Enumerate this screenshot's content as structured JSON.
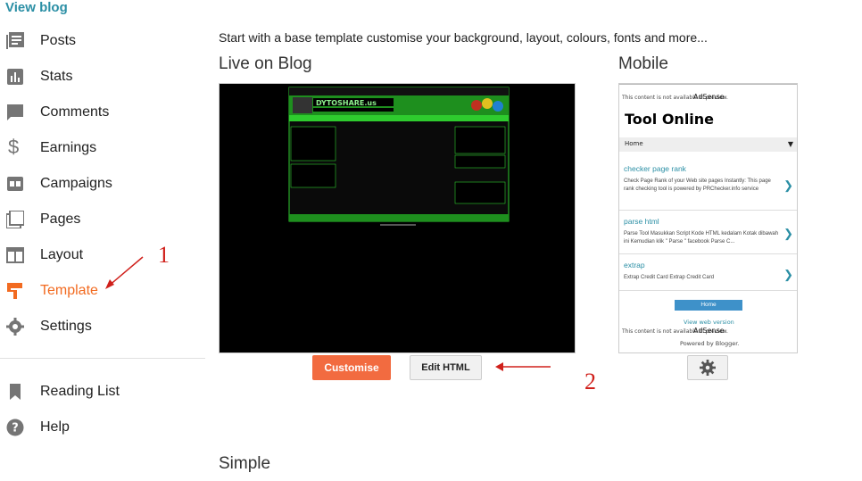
{
  "sidebar": {
    "view_blog": "View blog",
    "items": [
      {
        "label": "Posts",
        "icon": "posts-icon"
      },
      {
        "label": "Stats",
        "icon": "stats-icon"
      },
      {
        "label": "Comments",
        "icon": "comments-icon"
      },
      {
        "label": "Earnings",
        "icon": "dollar-icon"
      },
      {
        "label": "Campaigns",
        "icon": "campaigns-icon"
      },
      {
        "label": "Pages",
        "icon": "pages-icon"
      },
      {
        "label": "Layout",
        "icon": "layout-icon"
      },
      {
        "label": "Template",
        "icon": "template-icon",
        "active": true
      },
      {
        "label": "Settings",
        "icon": "gear-icon"
      }
    ],
    "secondary": [
      {
        "label": "Reading List",
        "icon": "bookmark-icon"
      },
      {
        "label": "Help",
        "icon": "help-icon"
      }
    ],
    "active_color": "#f26b21"
  },
  "annotations": {
    "one": "1",
    "two": "2"
  },
  "main": {
    "intro": "Start with a base template customise your background, layout, colours, fonts and more...",
    "live_heading": "Live on Blog",
    "mobile_heading": "Mobile",
    "simple_heading": "Simple",
    "customise_label": "Customise",
    "edit_html_label": "Edit HTML",
    "preview_site_title": "DYTOSHARE.us"
  },
  "mobile_preview": {
    "notice_top": "This content is not available in preview.",
    "adsense": "AdSense",
    "blog_title": "Tool Online",
    "home_select": "Home",
    "home_caret": "▼",
    "posts": [
      {
        "title": "checker page rank",
        "desc": "Check Page Rank of your Web site pages Instantly: This page rank checking tool is powered by PRChecker.info service"
      },
      {
        "title": "parse html",
        "desc": "Parse Tool Masukkan Script Kode HTML kedalam Kotak dibawah ini Kemudian klik \" Parse \" facebook Parse C..."
      },
      {
        "title": "extrap",
        "desc": "Extrap Credit Card Extrap Credit Card"
      }
    ],
    "home_button": "Home",
    "view_web_version": "View web version",
    "notice_bottom": "This content is not available in preview.",
    "powered_by": "Powered by Blogger."
  },
  "colors": {
    "accent": "#f26b40",
    "link": "#2b8fa5",
    "annotation": "#d0201b"
  }
}
